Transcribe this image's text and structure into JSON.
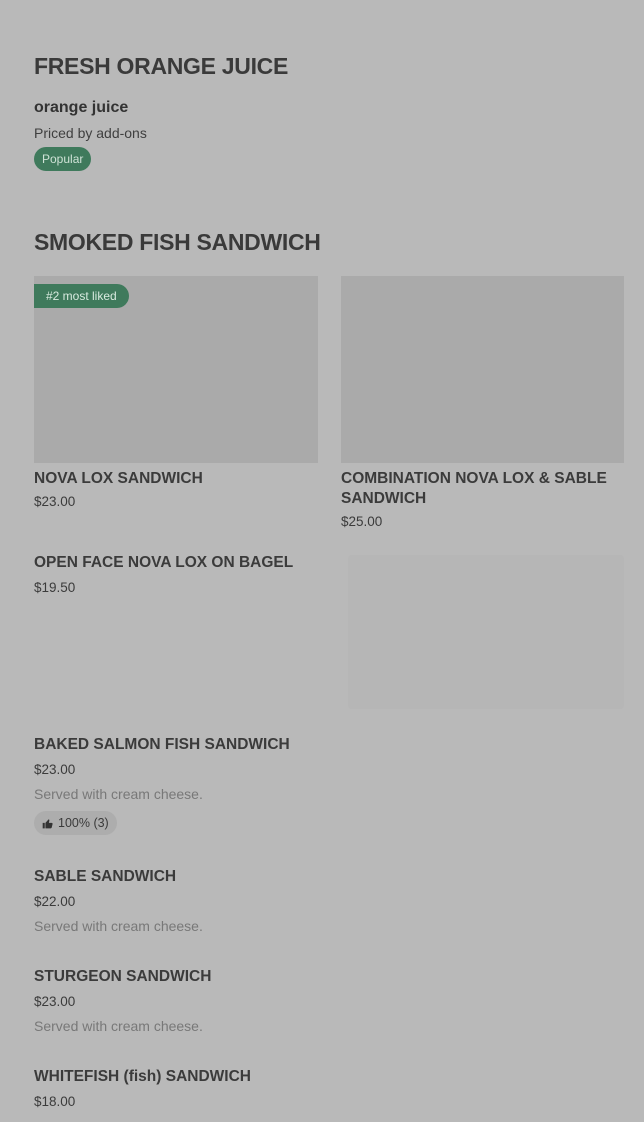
{
  "sections": [
    {
      "title": "FRESH ORANGE JUICE",
      "item": {
        "name": "orange juice",
        "description": "Priced by add-ons",
        "badge": "Popular"
      }
    },
    {
      "title": "SMOKED FISH SANDWICH",
      "cards": [
        {
          "name": "NOVA LOX SANDWICH",
          "price": "$23.00",
          "badge": "#2 most liked"
        },
        {
          "name": "COMBINATION NOVA LOX & SABLE SANDWICH",
          "price": "$25.00"
        }
      ],
      "items": [
        {
          "name": "OPEN FACE NOVA LOX ON BAGEL",
          "price": "$19.50"
        },
        {
          "name": "BAKED SALMON FISH SANDWICH",
          "price": "$23.00",
          "description": "Served with cream cheese.",
          "likes": "100% (3)"
        },
        {
          "name": "SABLE SANDWICH",
          "price": "$22.00",
          "description": "Served with cream cheese."
        },
        {
          "name": "STURGEON SANDWICH",
          "price": "$23.00",
          "description": "Served with cream cheese."
        },
        {
          "name": "WHITEFISH (fish) SANDWICH",
          "price": "$18.00"
        }
      ]
    }
  ],
  "colors": {
    "background": "#b9b9b9",
    "badge_green": "#3f7a5c",
    "image_placeholder": "#aaaaaa"
  },
  "icons": {
    "likes": "thumbs-up-icon"
  }
}
